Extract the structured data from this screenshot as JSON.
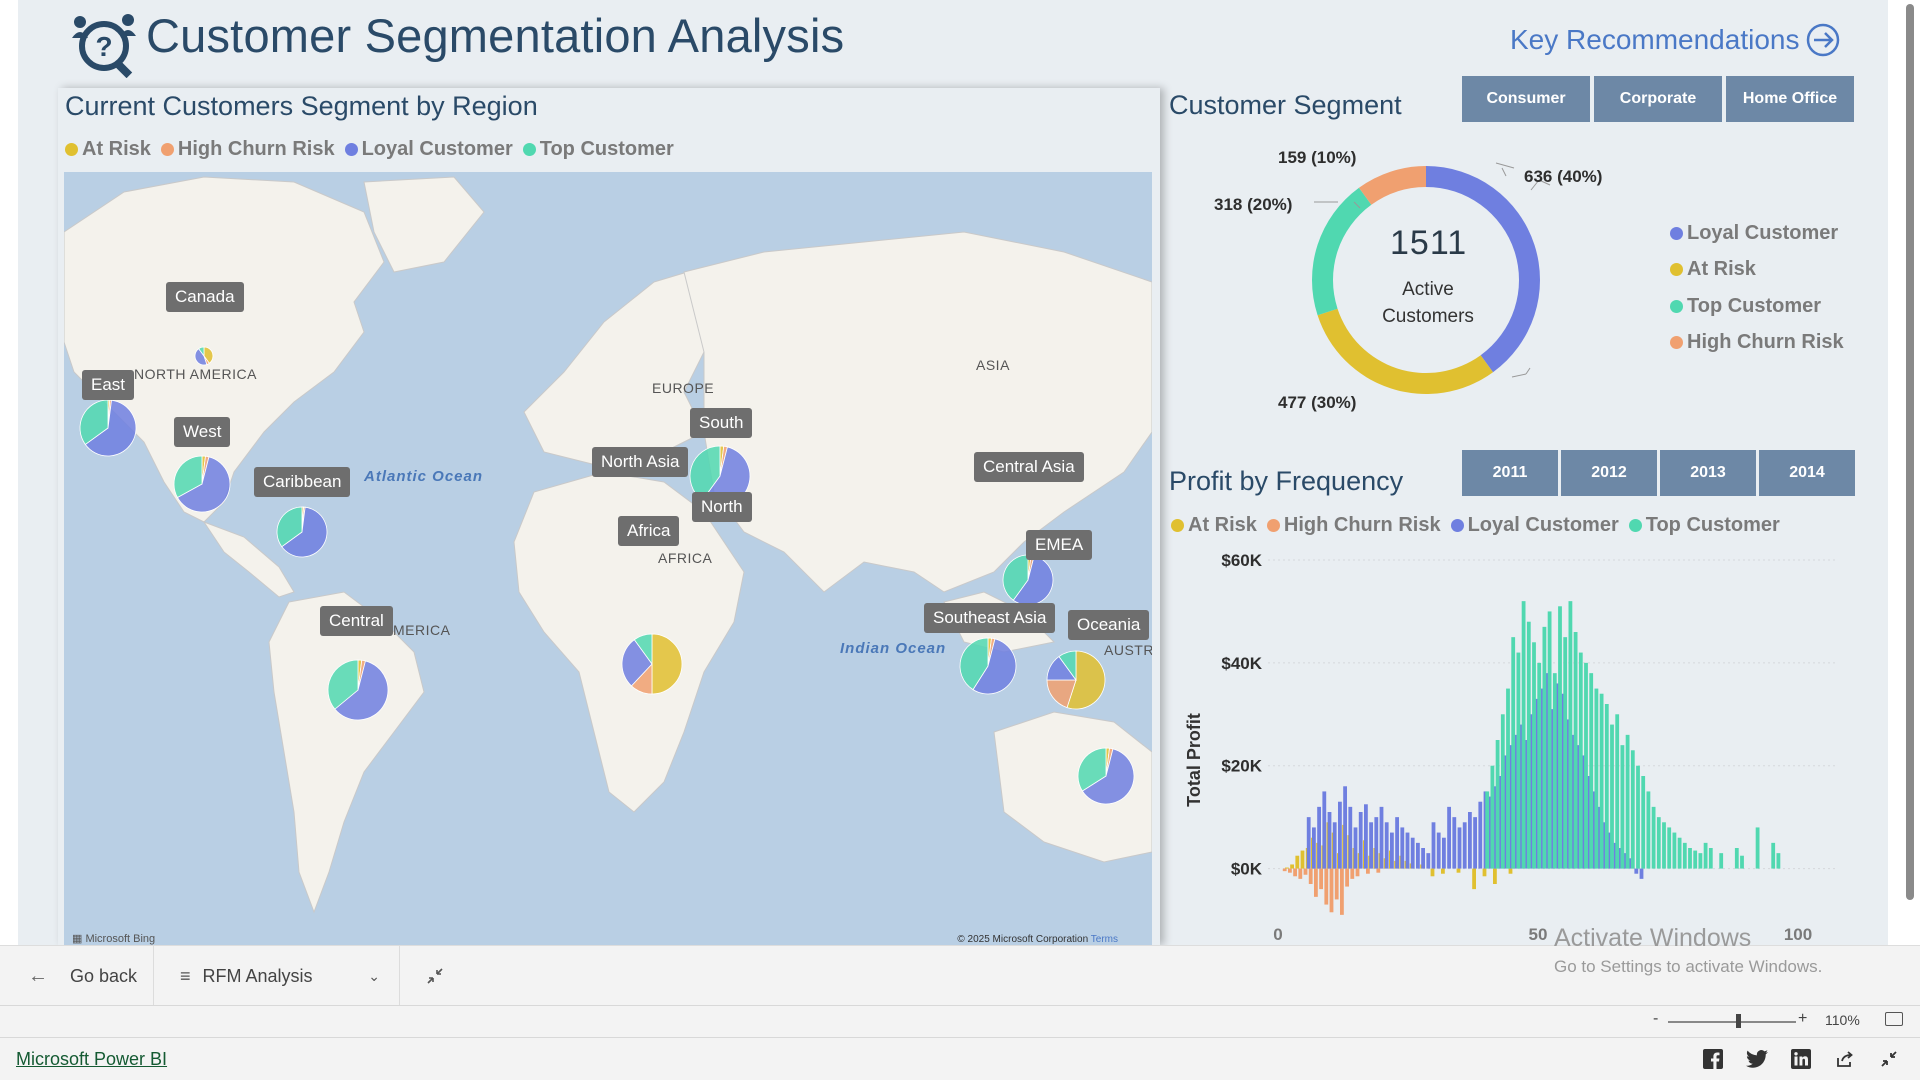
{
  "header": {
    "title": "Customer Segmentation Analysis",
    "key_recommendations": "Key Recommendations"
  },
  "map_panel": {
    "title": "Current Customers Segment by Region",
    "legend": [
      {
        "label": "At Risk",
        "color": "#e0c030"
      },
      {
        "label": "High Churn Risk",
        "color": "#f0a070"
      },
      {
        "label": "Loyal Customer",
        "color": "#6f7fe0"
      },
      {
        "label": "Top Customer",
        "color": "#50d8b0"
      }
    ],
    "regions": [
      "Canada",
      "East",
      "West",
      "Caribbean",
      "Central",
      "South",
      "North Asia",
      "North",
      "Africa",
      "Central Asia",
      "EMEA",
      "Southeast Asia",
      "Oceania"
    ],
    "geo_labels": [
      "NORTH AMERICA",
      "EUROPE",
      "ASIA",
      "AFRICA",
      "SOUTH AMERICA",
      "AUSTRA"
    ],
    "oceans": [
      "Atlantic Ocean",
      "Indian Ocean"
    ],
    "bing": "Microsoft Bing",
    "copyright": "© 2025 Microsoft Corporation",
    "terms": "Terms"
  },
  "segment_panel": {
    "title": "Customer Segment",
    "buttons": [
      "Consumer",
      "Corporate",
      "Home Office"
    ],
    "center_value": "1511",
    "center_label_1": "Active",
    "center_label_2": "Customers",
    "slices": [
      {
        "label": "Loyal Customer",
        "value": 636,
        "text": "636 (40%)",
        "color": "#6f7fe0"
      },
      {
        "label": "At Risk",
        "value": 477,
        "text": "477 (30%)",
        "color": "#e0c030"
      },
      {
        "label": "Top Customer",
        "value": 318,
        "text": "318 (20%)",
        "color": "#50d8b0"
      },
      {
        "label": "High Churn Risk",
        "value": 159,
        "text": "159 (10%)",
        "color": "#f0a070"
      }
    ],
    "legend": [
      "Loyal Customer",
      "At Risk",
      "Top Customer",
      "High Churn Risk"
    ]
  },
  "profit_panel": {
    "title": "Profit by Frequency",
    "years": [
      "2011",
      "2012",
      "2013",
      "2014"
    ],
    "legend": [
      "At Risk",
      "High Churn Risk",
      "Loyal Customer",
      "Top Customer"
    ]
  },
  "chart_data": {
    "type": "bar",
    "ylabel": "Total Profit",
    "xlabel": "",
    "yticks": [
      "$60K",
      "$40K",
      "$20K",
      "$0K"
    ],
    "xticks": [
      "0",
      "50",
      "100"
    ],
    "xlim": [
      0,
      100
    ],
    "ylim": [
      -10000,
      60000
    ],
    "series": [
      {
        "name": "At Risk",
        "color": "#e0c030",
        "x": [
          2,
          3,
          4,
          5,
          6,
          7,
          8,
          9,
          10,
          11,
          12,
          13,
          14,
          15,
          16,
          17,
          18,
          19,
          20,
          21,
          22,
          23,
          24,
          25,
          26,
          28,
          30,
          32,
          35,
          38,
          40,
          42,
          45
        ],
        "values": [
          200,
          800,
          2500,
          3500,
          4000,
          6000,
          5000,
          4500,
          9000,
          7000,
          3000,
          8500,
          6500,
          4000,
          3000,
          5500,
          2500,
          4000,
          3000,
          2000,
          3500,
          1500,
          2500,
          1500,
          1000,
          800,
          -1500,
          -1000,
          -800,
          -4000,
          -1500,
          -3000,
          -1000
        ]
      },
      {
        "name": "High Churn Risk",
        "color": "#f0a070",
        "x": [
          1,
          2,
          3,
          4,
          5,
          6,
          7,
          8,
          9,
          10,
          11,
          12,
          13,
          14,
          15,
          17,
          19
        ],
        "values": [
          -500,
          -800,
          -1500,
          -2000,
          -1200,
          -3000,
          -5500,
          -4000,
          -7000,
          -8500,
          -6000,
          -9000,
          -3500,
          -2000,
          -1500,
          -1000,
          -800
        ]
      },
      {
        "name": "Loyal Customer",
        "color": "#6f7fe0",
        "x": [
          6,
          7,
          8,
          9,
          10,
          11,
          12,
          13,
          14,
          15,
          16,
          17,
          18,
          19,
          20,
          21,
          22,
          23,
          24,
          25,
          26,
          27,
          28,
          29,
          30,
          31,
          32,
          33,
          34,
          35,
          36,
          37,
          38,
          39,
          40,
          41,
          42,
          43,
          44,
          45,
          46,
          47,
          48,
          49,
          50,
          51,
          52,
          53,
          54,
          55,
          56,
          57,
          58,
          59,
          60,
          61,
          62,
          63,
          64,
          65,
          66,
          67,
          68,
          69,
          70
        ],
        "values": [
          10000,
          8000,
          12000,
          15000,
          11000,
          9000,
          13000,
          16000,
          12000,
          8000,
          11000,
          12500,
          9000,
          10000,
          12000,
          9000,
          7000,
          10000,
          8000,
          7000,
          6000,
          5000,
          4000,
          3000,
          9000,
          7000,
          6000,
          12000,
          10000,
          8000,
          9000,
          11000,
          10000,
          13000,
          15000,
          14000,
          16000,
          18000,
          22000,
          24000,
          26000,
          28000,
          25000,
          30000,
          33000,
          35000,
          38000,
          31000,
          36000,
          34000,
          29000,
          26000,
          24000,
          22000,
          18000,
          15000,
          12000,
          9000,
          7000,
          5000,
          4000,
          3000,
          2000,
          -1000,
          -2000
        ]
      },
      {
        "name": "Top Customer",
        "color": "#50d8b0",
        "x": [
          40,
          41,
          42,
          43,
          44,
          45,
          46,
          47,
          48,
          49,
          50,
          51,
          52,
          53,
          54,
          55,
          56,
          57,
          58,
          59,
          60,
          61,
          62,
          63,
          64,
          65,
          66,
          67,
          68,
          69,
          70,
          71,
          72,
          73,
          74,
          75,
          76,
          77,
          78,
          79,
          80,
          81,
          82,
          83,
          85,
          88,
          89,
          92,
          95,
          96
        ],
        "values": [
          15000,
          20000,
          25000,
          30000,
          35000,
          45000,
          42000,
          52000,
          48000,
          44000,
          40000,
          47000,
          50000,
          38000,
          51000,
          45000,
          52000,
          46000,
          42000,
          40000,
          38000,
          35000,
          34000,
          32000,
          28000,
          30000,
          24000,
          26000,
          23000,
          20000,
          18000,
          15000,
          12000,
          10000,
          9000,
          8000,
          7000,
          6000,
          5000,
          4000,
          3500,
          3000,
          5000,
          4000,
          3000,
          4000,
          2500,
          8000,
          5000,
          3000
        ]
      }
    ]
  },
  "nav": {
    "go_back": "Go back",
    "page_name": "RFM Analysis"
  },
  "activate": {
    "line1": "Activate Windows",
    "line2": "Go to Settings to activate Windows."
  },
  "zoom": {
    "minus": "-",
    "plus": "+",
    "value": "110%",
    "level": 0.55
  },
  "footer": {
    "link": "Microsoft Power BI"
  }
}
